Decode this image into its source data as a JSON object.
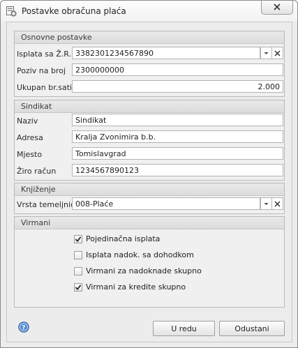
{
  "window": {
    "title": "Postavke obračuna plaća"
  },
  "osnovne": {
    "header": "Osnovne postavke",
    "isplata_label": "Isplata sa Ž.R.",
    "isplata_value": "3382301234567890",
    "poziv_label": "Poziv na broj",
    "poziv_value": "2300000000",
    "sati_label": "Ukupan br.sati",
    "sati_value": "2.000"
  },
  "sindikat": {
    "header": "Sindikat",
    "naziv_label": "Naziv",
    "naziv_value": "Sindikat",
    "adresa_label": "Adresa",
    "adresa_value": "Kralja Zvonimira b.b.",
    "mjesto_label": "Mjesto",
    "mjesto_value": "Tomislavgrad",
    "ziro_label": "Žiro račun",
    "ziro_value": "1234567890123"
  },
  "knjizenje": {
    "header": "Knjiženje",
    "vrsta_label": "Vrsta temeljnice",
    "vrsta_value": "008-Plaće"
  },
  "virmani": {
    "header": "Virmani",
    "options": [
      {
        "label": "Pojedinačna isplata",
        "checked": true
      },
      {
        "label": "Isplata nadok. sa dohodkom",
        "checked": false
      },
      {
        "label": "Virmani za nadoknade skupno",
        "checked": false
      },
      {
        "label": "Virmani za kredite skupno",
        "checked": true
      }
    ]
  },
  "buttons": {
    "ok": "U redu",
    "cancel": "Odustani"
  },
  "icons": {
    "app": "settings-window-icon",
    "close": "close-icon",
    "dropdown": "chevron-down-icon",
    "clear": "clear-x-icon",
    "help": "help-icon",
    "check": "checkmark-icon"
  }
}
